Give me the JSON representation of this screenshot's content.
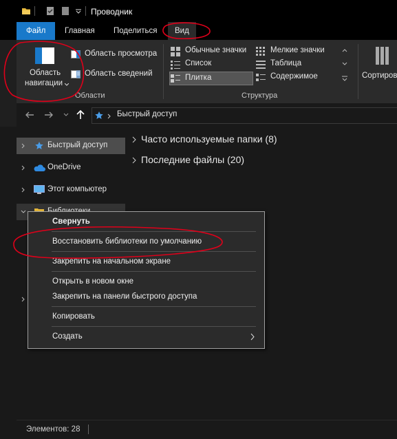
{
  "window": {
    "title": "Проводник"
  },
  "tabs": [
    {
      "label": "Файл"
    },
    {
      "label": "Главная"
    },
    {
      "label": "Поделиться"
    },
    {
      "label": "Вид"
    }
  ],
  "ribbon": {
    "nav_pane_line1": "Область",
    "nav_pane_line2": "навигации",
    "preview_pane": "Область просмотра",
    "details_pane": "Область сведений",
    "areas_label": "Области",
    "layout": {
      "large_icons": "Обычные значки",
      "small_icons": "Мелкие значки",
      "list": "Список",
      "table": "Таблица",
      "tiles": "Плитка",
      "content": "Содержимое"
    },
    "structure_label": "Структура",
    "sort_label": "Сортиров"
  },
  "address": {
    "path": "Быстрый доступ"
  },
  "nav": {
    "items": [
      {
        "label": "Быстрый доступ"
      },
      {
        "label": "OneDrive"
      },
      {
        "label": "Этот компьютер"
      },
      {
        "label": "Библиотеки"
      }
    ]
  },
  "content": {
    "frequent": "Часто используемые папки (8)",
    "recent": "Последние файлы (20)"
  },
  "context_menu": {
    "items": [
      {
        "label": "Свернуть"
      },
      {
        "label": "Восстановить библиотеки по умолчанию"
      },
      {
        "label": "Закрепить на начальном экране"
      },
      {
        "label": "Открыть в новом окне"
      },
      {
        "label": "Закрепить на панели быстрого доступа"
      },
      {
        "label": "Копировать"
      },
      {
        "label": "Создать"
      }
    ]
  },
  "status": {
    "items_count": "Элементов: 28"
  },
  "colors": {
    "accent": "#1979ca",
    "annotation": "#e0001a",
    "background": "#191919",
    "ribbon": "#2b2b2b"
  }
}
